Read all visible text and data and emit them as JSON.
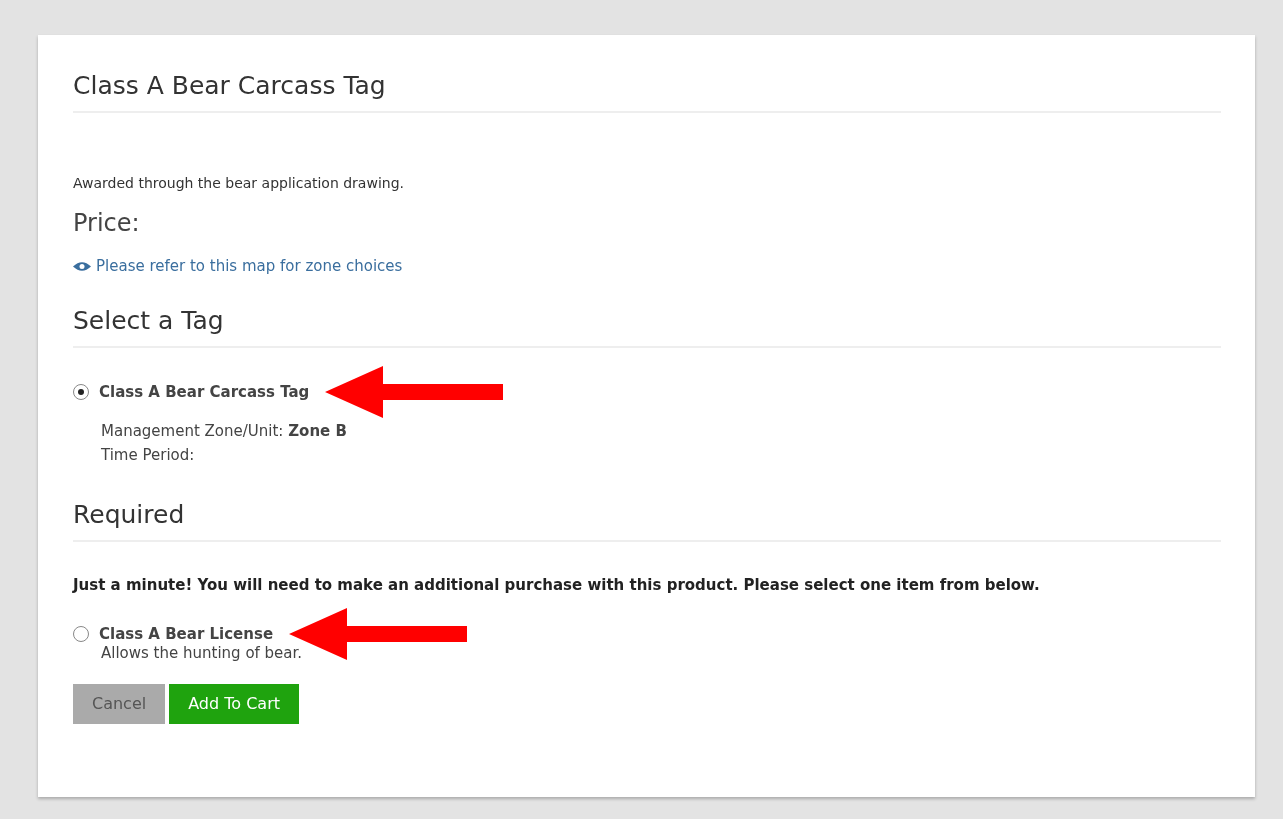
{
  "title": "Class A Bear Carcass Tag",
  "description": "Awarded through the bear application drawing.",
  "price_label": "Price:",
  "map_link": "Please refer to this map for zone choices",
  "tag_section": {
    "heading": "Select a Tag",
    "options": [
      {
        "label": "Class A Bear Carcass Tag",
        "selected": true,
        "details": [
          {
            "label": "Management Zone/Unit:",
            "value": "Zone B"
          },
          {
            "label": "Time Period:"
          }
        ]
      }
    ]
  },
  "required_section": {
    "heading": "Required",
    "note": "Just a minute!  You will need to make an additional purchase with this product.  Please select one item from below.",
    "options": [
      {
        "label": "Class A Bear License",
        "selected": false,
        "description": "Allows the hunting of bear."
      }
    ]
  },
  "buttons": [
    {
      "label": "Cancel",
      "kind": "secondary"
    },
    {
      "label": "Add To Cart",
      "kind": "primary"
    }
  ]
}
